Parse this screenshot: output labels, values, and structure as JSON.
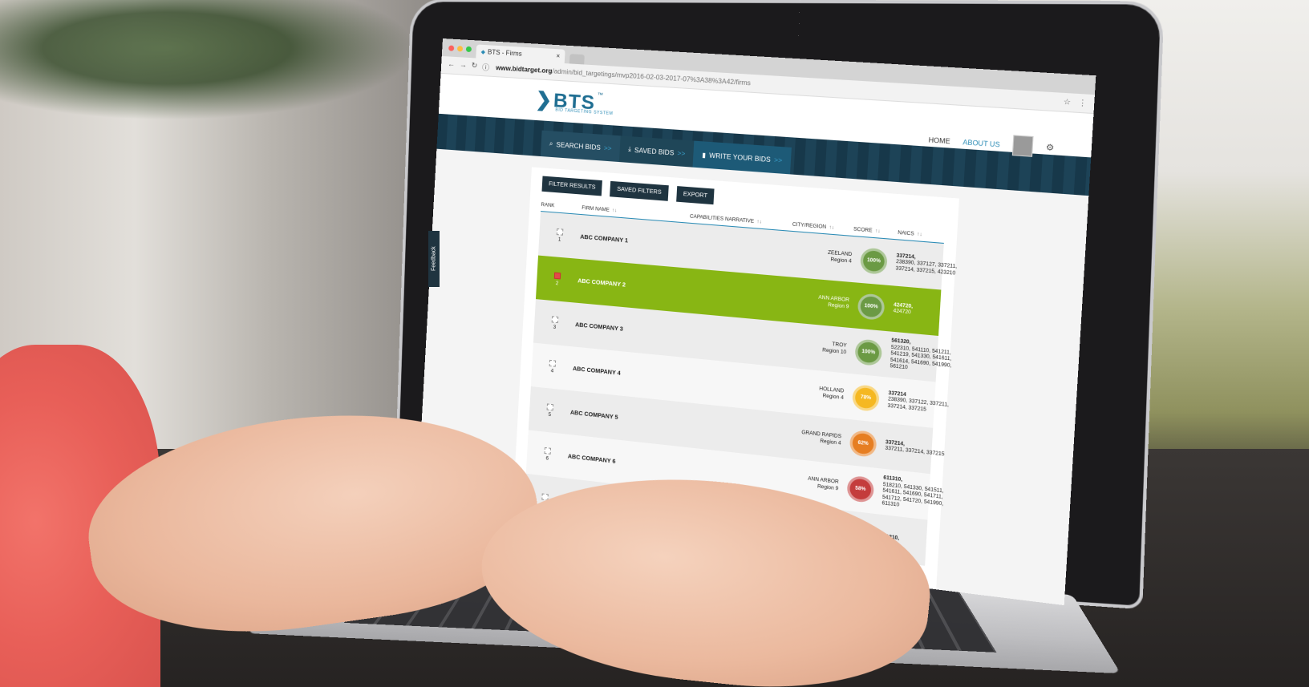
{
  "browser": {
    "tab_title": "BTS - Firms",
    "tab_close": "×",
    "url_host": "www.bidtarget.org",
    "url_path": "/admin/bid_targetings/mvp2016-02-03-2017-07%3A38%3A42/firms"
  },
  "site": {
    "logo_text": "BTS",
    "logo_tm": "™",
    "logo_sub": "BID TARGETING SYSTEM",
    "nav": {
      "home": "HOME",
      "about": "ABOUT US"
    }
  },
  "banner": {
    "items": [
      {
        "label": "SEARCH BIDS",
        "arrows": ">>"
      },
      {
        "label": "SAVED BIDS",
        "arrows": ">>"
      },
      {
        "label": "WRITE YOUR BIDS",
        "arrows": ">>"
      }
    ]
  },
  "actions": {
    "filter": "FILTER RESULTS",
    "saved_filters": "SAVED FILTERS",
    "export": "EXPORT"
  },
  "table": {
    "headers": {
      "rank": "RANK",
      "firm": "FIRM NAME",
      "capabilities": "CAPABILITIES NARRATIVE",
      "city": "CITY/REGION",
      "score": "SCORE",
      "naics": "NAICS",
      "sort": "↑↓"
    },
    "rows": [
      {
        "rank": "1",
        "firm": "ABC COMPANY 1",
        "city": "ZEELAND",
        "region": "Region 4",
        "score": "100%",
        "score_color": "#6b9a44",
        "naics_first": "337214,",
        "naics_rest": "238390, 337127, 337211, 337214, 337215, 423210"
      },
      {
        "rank": "2",
        "firm": "ABC COMPANY 2",
        "city": "ANN ARBOR",
        "region": "Region 9",
        "score": "100%",
        "score_color": "#6b9a44",
        "naics_first": "424720,",
        "naics_rest": "424720"
      },
      {
        "rank": "3",
        "firm": "ABC COMPANY 3",
        "city": "TROY",
        "region": "Region 10",
        "score": "100%",
        "score_color": "#6b9a44",
        "naics_first": "561320,",
        "naics_rest": "522310, 541110, 541211, 541219, 541330, 541611, 541614, 541690, 541990, 561210"
      },
      {
        "rank": "4",
        "firm": "ABC COMPANY 4",
        "city": "HOLLAND",
        "region": "Region 4",
        "score": "78%",
        "score_color": "#f5b822",
        "naics_first": "337214",
        "naics_rest": "238390, 337122, 337211, 337214, 337215"
      },
      {
        "rank": "5",
        "firm": "ABC COMPANY 5",
        "city": "GRAND RAPIDS",
        "region": "Region 4",
        "score": "62%",
        "score_color": "#e67e22",
        "naics_first": "337214,",
        "naics_rest": "337211, 337214, 337215"
      },
      {
        "rank": "6",
        "firm": "ABC COMPANY 6",
        "city": "ANN ARBOR",
        "region": "Region 9",
        "score": "58%",
        "score_color": "#c43c3c",
        "naics_first": "611310,",
        "naics_rest": "518210, 541330, 541511, 541611, 541690, 541711, 541712, 541720, 541990, 611310"
      },
      {
        "rank": "",
        "firm": "",
        "city": "",
        "region": "",
        "score": "",
        "score_color": "#6b9a44",
        "naics_first": "561210,",
        "naics_rest": ""
      }
    ]
  },
  "feedback": "Feedback"
}
